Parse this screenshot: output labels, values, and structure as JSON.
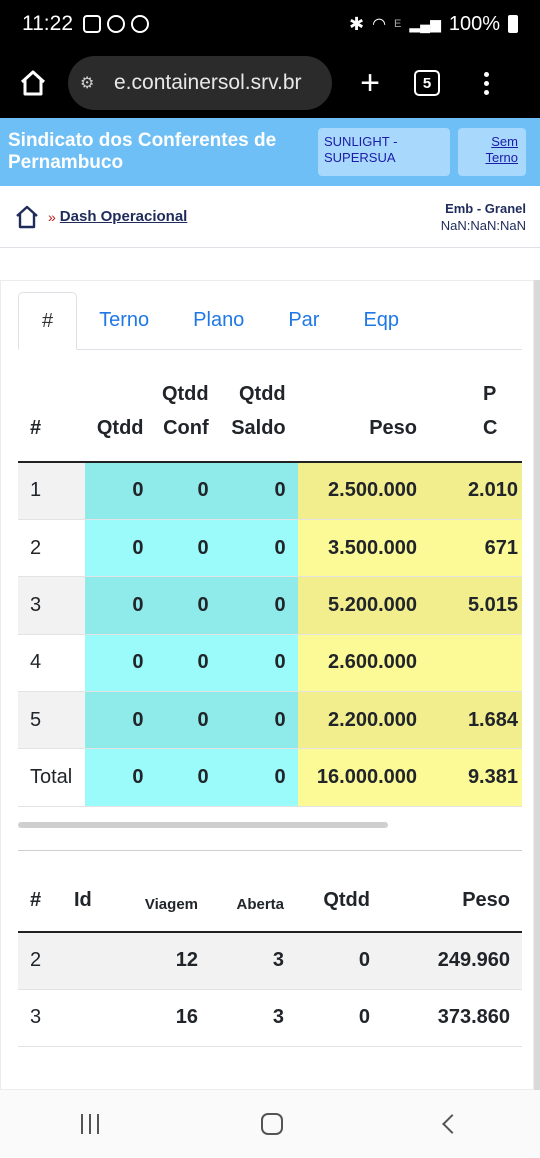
{
  "status_bar": {
    "time": "11:22",
    "signal_label": "E",
    "battery": "100%"
  },
  "browser": {
    "url": "e.containersol.srv.br",
    "tab_count": "5"
  },
  "header": {
    "title": "Sindicato dos Conferentes de Pernambuco",
    "ship_badge": "SUNLIGHT - SUPERSUA",
    "terno_badge": "Sem Terno"
  },
  "breadcrumb": {
    "separator": "»",
    "page_link": "Dash Operacional",
    "operation": "Emb - Granel",
    "date": "NaN:NaN:NaN"
  },
  "tabs": [
    "#",
    "Terno",
    "Plano",
    "Par",
    "Eqp"
  ],
  "table1": {
    "headers": {
      "num": "#",
      "qtdd": "Qtdd",
      "qtdd_conf_1": "Qtdd",
      "qtdd_conf_2": "Conf",
      "qtdd_saldo_1": "Qtdd",
      "qtdd_saldo_2": "Saldo",
      "peso": "Peso",
      "next_1": "P",
      "next_2": "C"
    },
    "rows": [
      {
        "num": "1",
        "qtdd": "0",
        "conf": "0",
        "saldo": "0",
        "peso": "2.500.000",
        "peso_conf": "2.010"
      },
      {
        "num": "2",
        "qtdd": "0",
        "conf": "0",
        "saldo": "0",
        "peso": "3.500.000",
        "peso_conf": "671"
      },
      {
        "num": "3",
        "qtdd": "0",
        "conf": "0",
        "saldo": "0",
        "peso": "5.200.000",
        "peso_conf": "5.015"
      },
      {
        "num": "4",
        "qtdd": "0",
        "conf": "0",
        "saldo": "0",
        "peso": "2.600.000",
        "peso_conf": ""
      },
      {
        "num": "5",
        "qtdd": "0",
        "conf": "0",
        "saldo": "0",
        "peso": "2.200.000",
        "peso_conf": "1.684"
      },
      {
        "num": "Total",
        "qtdd": "0",
        "conf": "0",
        "saldo": "0",
        "peso": "16.000.000",
        "peso_conf": "9.381"
      }
    ]
  },
  "table2": {
    "headers": {
      "num": "#",
      "id": "Id",
      "viagem": "Viagem",
      "aberta": "Aberta",
      "qtdd": "Qtdd",
      "peso": "Peso"
    },
    "rows": [
      {
        "num": "2",
        "id": "",
        "viagem": "12",
        "aberta": "3",
        "qtdd": "0",
        "peso": "249.960"
      },
      {
        "num": "3",
        "id": "",
        "viagem": "16",
        "aberta": "3",
        "qtdd": "0",
        "peso": "373.860"
      }
    ]
  },
  "colors": {
    "header_bg": "#6ebff6",
    "cyan": "#9bfbfb",
    "yellow": "#fcfa96",
    "link": "#1e78e6"
  }
}
